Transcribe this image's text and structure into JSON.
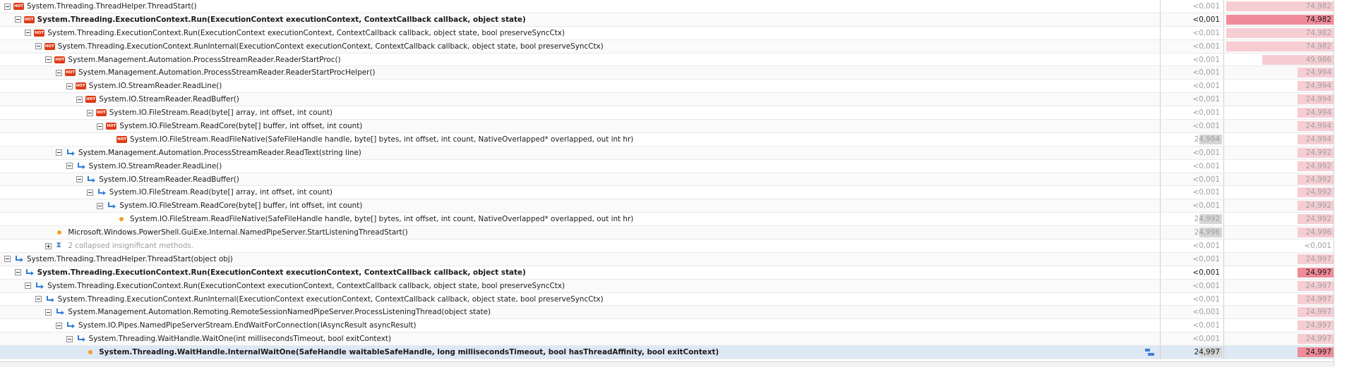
{
  "rows": [
    {
      "indent": 0,
      "toggle": "minus",
      "icon": "hot",
      "label": "System.Threading.ThreadHelper.ThreadStart()",
      "bold": false,
      "muted": false,
      "own": "<0,001",
      "own_strong": false,
      "total": "74,982",
      "total_strong": false,
      "total_fraction": 1.0
    },
    {
      "indent": 1,
      "toggle": "minus",
      "icon": "hot",
      "label": "System.Threading.ExecutionContext.Run(ExecutionContext executionContext, ContextCallback callback, object state)",
      "bold": true,
      "muted": false,
      "own": "<0,001",
      "own_strong": true,
      "total": "74,982",
      "total_strong": true,
      "total_fraction": 1.0
    },
    {
      "indent": 2,
      "toggle": "minus",
      "icon": "hot",
      "label": "System.Threading.ExecutionContext.Run(ExecutionContext executionContext, ContextCallback callback, object state, bool preserveSyncCtx)",
      "bold": false,
      "muted": false,
      "own": "<0,001",
      "own_strong": false,
      "total": "74,982",
      "total_strong": false,
      "total_fraction": 1.0
    },
    {
      "indent": 3,
      "toggle": "minus",
      "icon": "hot",
      "label": "System.Threading.ExecutionContext.RunInternal(ExecutionContext executionContext, ContextCallback callback, object state, bool preserveSyncCtx)",
      "bold": false,
      "muted": false,
      "own": "<0,001",
      "own_strong": false,
      "total": "74,982",
      "total_strong": false,
      "total_fraction": 1.0
    },
    {
      "indent": 4,
      "toggle": "minus",
      "icon": "hot",
      "label": "System.Management.Automation.ProcessStreamReader.ReaderStartProc()",
      "bold": false,
      "muted": false,
      "own": "<0,001",
      "own_strong": false,
      "total": "49,986",
      "total_strong": false,
      "total_fraction": 0.667
    },
    {
      "indent": 5,
      "toggle": "minus",
      "icon": "hot",
      "label": "System.Management.Automation.ProcessStreamReader.ReaderStartProcHelper()",
      "bold": false,
      "muted": false,
      "own": "<0,001",
      "own_strong": false,
      "total": "24,994",
      "total_strong": false,
      "total_fraction": 0.333
    },
    {
      "indent": 6,
      "toggle": "minus",
      "icon": "hot",
      "label": "System.IO.StreamReader.ReadLine()",
      "bold": false,
      "muted": false,
      "own": "<0,001",
      "own_strong": false,
      "total": "24,994",
      "total_strong": false,
      "total_fraction": 0.333
    },
    {
      "indent": 7,
      "toggle": "minus",
      "icon": "hot",
      "label": "System.IO.StreamReader.ReadBuffer()",
      "bold": false,
      "muted": false,
      "own": "<0,001",
      "own_strong": false,
      "total": "24,994",
      "total_strong": false,
      "total_fraction": 0.333
    },
    {
      "indent": 8,
      "toggle": "minus",
      "icon": "hot",
      "label": "System.IO.FileStream.Read(byte[] array, int offset, int count)",
      "bold": false,
      "muted": false,
      "own": "<0,001",
      "own_strong": false,
      "total": "24,994",
      "total_strong": false,
      "total_fraction": 0.333
    },
    {
      "indent": 9,
      "toggle": "minus",
      "icon": "hot",
      "label": "System.IO.FileStream.ReadCore(byte[] buffer, int offset, int count)",
      "bold": false,
      "muted": false,
      "own": "<0,001",
      "own_strong": false,
      "total": "24,994",
      "total_strong": false,
      "total_fraction": 0.333
    },
    {
      "indent": 10,
      "toggle": "none",
      "icon": "hot",
      "label": "System.IO.FileStream.ReadFileNative(SafeFileHandle handle, byte[] bytes, int offset, int count, NativeOverlapped* overlapped, out int hr)",
      "bold": false,
      "muted": false,
      "own": "24,994",
      "own_strong": false,
      "own_fraction": 0.4,
      "total": "24,994",
      "total_strong": false,
      "total_fraction": 0.333
    },
    {
      "indent": 5,
      "toggle": "minus",
      "icon": "arrow",
      "label": "System.Management.Automation.ProcessStreamReader.ReadText(string line)",
      "bold": false,
      "muted": false,
      "own": "<0,001",
      "own_strong": false,
      "total": "24,992",
      "total_strong": false,
      "total_fraction": 0.333
    },
    {
      "indent": 6,
      "toggle": "minus",
      "icon": "arrow",
      "label": "System.IO.StreamReader.ReadLine()",
      "bold": false,
      "muted": false,
      "own": "<0,001",
      "own_strong": false,
      "total": "24,992",
      "total_strong": false,
      "total_fraction": 0.333
    },
    {
      "indent": 7,
      "toggle": "minus",
      "icon": "arrow",
      "label": "System.IO.StreamReader.ReadBuffer()",
      "bold": false,
      "muted": false,
      "own": "<0,001",
      "own_strong": false,
      "total": "24,992",
      "total_strong": false,
      "total_fraction": 0.333
    },
    {
      "indent": 8,
      "toggle": "minus",
      "icon": "arrow",
      "label": "System.IO.FileStream.Read(byte[] array, int offset, int count)",
      "bold": false,
      "muted": false,
      "own": "<0,001",
      "own_strong": false,
      "total": "24,992",
      "total_strong": false,
      "total_fraction": 0.333
    },
    {
      "indent": 9,
      "toggle": "minus",
      "icon": "arrow",
      "label": "System.IO.FileStream.ReadCore(byte[] buffer, int offset, int count)",
      "bold": false,
      "muted": false,
      "own": "<0,001",
      "own_strong": false,
      "total": "24,992",
      "total_strong": false,
      "total_fraction": 0.333
    },
    {
      "indent": 10,
      "toggle": "none",
      "icon": "dot",
      "label": "System.IO.FileStream.ReadFileNative(SafeFileHandle handle, byte[] bytes, int offset, int count, NativeOverlapped* overlapped, out int hr)",
      "bold": false,
      "muted": false,
      "own": "24,992",
      "own_strong": false,
      "own_fraction": 0.4,
      "total": "24,992",
      "total_strong": false,
      "total_fraction": 0.333
    },
    {
      "indent": 4,
      "toggle": "none",
      "icon": "dot",
      "label": "Microsoft.Windows.PowerShell.GuiExe.Internal.NamedPipeServer.StartListeningThreadStart()",
      "bold": false,
      "muted": false,
      "own": "24,996",
      "own_strong": false,
      "own_fraction": 0.4,
      "total": "24,996",
      "total_strong": false,
      "total_fraction": 0.333
    },
    {
      "indent": 4,
      "toggle": "plus",
      "icon": "collapse",
      "label": "2 collapsed insignificant methods.",
      "bold": false,
      "muted": true,
      "own": "<0,001",
      "own_strong": false,
      "total": "<0,001",
      "total_strong": false,
      "total_fraction": 0
    },
    {
      "indent": 0,
      "toggle": "minus",
      "icon": "arrow",
      "label": "System.Threading.ThreadHelper.ThreadStart(object obj)",
      "bold": false,
      "muted": false,
      "own": "<0,001",
      "own_strong": false,
      "total": "24,997",
      "total_strong": false,
      "total_fraction": 0.333
    },
    {
      "indent": 1,
      "toggle": "minus",
      "icon": "arrow",
      "label": "System.Threading.ExecutionContext.Run(ExecutionContext executionContext, ContextCallback callback, object state)",
      "bold": true,
      "muted": false,
      "own": "<0,001",
      "own_strong": true,
      "total": "24,997",
      "total_strong": true,
      "total_fraction": 0.333
    },
    {
      "indent": 2,
      "toggle": "minus",
      "icon": "arrow",
      "label": "System.Threading.ExecutionContext.Run(ExecutionContext executionContext, ContextCallback callback, object state, bool preserveSyncCtx)",
      "bold": false,
      "muted": false,
      "own": "<0,001",
      "own_strong": false,
      "total": "24,997",
      "total_strong": false,
      "total_fraction": 0.333
    },
    {
      "indent": 3,
      "toggle": "minus",
      "icon": "arrow",
      "label": "System.Threading.ExecutionContext.RunInternal(ExecutionContext executionContext, ContextCallback callback, object state, bool preserveSyncCtx)",
      "bold": false,
      "muted": false,
      "own": "<0,001",
      "own_strong": false,
      "total": "24,997",
      "total_strong": false,
      "total_fraction": 0.333
    },
    {
      "indent": 4,
      "toggle": "minus",
      "icon": "arrow",
      "label": "System.Management.Automation.Remoting.RemoteSessionNamedPipeServer.ProcessListeningThread(object state)",
      "bold": false,
      "muted": false,
      "own": "<0,001",
      "own_strong": false,
      "total": "24,997",
      "total_strong": false,
      "total_fraction": 0.333
    },
    {
      "indent": 5,
      "toggle": "minus",
      "icon": "arrow",
      "label": "System.IO.Pipes.NamedPipeServerStream.EndWaitForConnection(IAsyncResult asyncResult)",
      "bold": false,
      "muted": false,
      "own": "<0,001",
      "own_strong": false,
      "total": "24,997",
      "total_strong": false,
      "total_fraction": 0.333
    },
    {
      "indent": 6,
      "toggle": "minus",
      "icon": "arrow",
      "label": "System.Threading.WaitHandle.WaitOne(int millisecondsTimeout, bool exitContext)",
      "bold": false,
      "muted": false,
      "own": "<0,001",
      "own_strong": false,
      "total": "24,997",
      "total_strong": false,
      "total_fraction": 0.333
    },
    {
      "indent": 7,
      "toggle": "none",
      "icon": "dot",
      "label": "System.Threading.WaitHandle.InternalWaitOne(SafeHandle waitableSafeHandle, long millisecondsTimeout, bool hasThreadAffinity, bool exitContext)",
      "bold": true,
      "muted": false,
      "own": "24,997",
      "own_strong": true,
      "own_fraction": 0.4,
      "total": "24,997",
      "total_strong": true,
      "total_fraction": 0.333,
      "selected": true,
      "extra_icon": "source-icon"
    }
  ]
}
